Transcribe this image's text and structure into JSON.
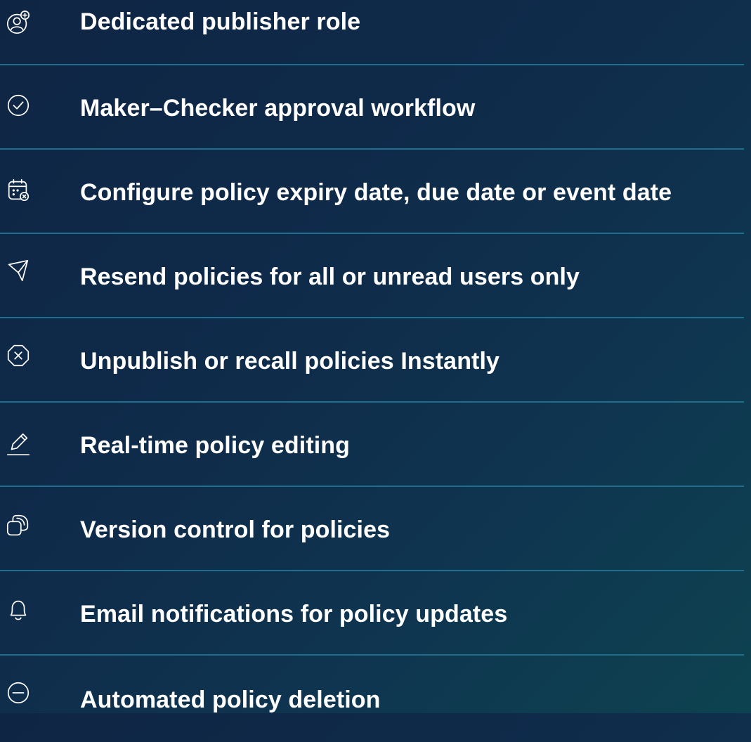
{
  "features": [
    {
      "label": "Dedicated publisher role",
      "icon": "user-add-icon"
    },
    {
      "label": "Maker–Checker approval workflow",
      "icon": "check-circle-icon"
    },
    {
      "label": "Configure policy expiry date, due date or event date",
      "icon": "calendar-icon"
    },
    {
      "label": "Resend policies for all or unread users only",
      "icon": "send-icon"
    },
    {
      "label": "Unpublish or recall policies Instantly",
      "icon": "close-circle-icon"
    },
    {
      "label": "Real-time policy editing",
      "icon": "edit-icon"
    },
    {
      "label": "Version control for policies",
      "icon": "versions-icon"
    },
    {
      "label": "Email notifications for policy updates",
      "icon": "bell-icon"
    },
    {
      "label": "Automated policy deletion",
      "icon": "minus-circle-icon"
    }
  ],
  "colors": {
    "background_start": "#0f2544",
    "background_end": "#0d4350",
    "divider": "#1d6f8c",
    "text": "#ffffff"
  }
}
